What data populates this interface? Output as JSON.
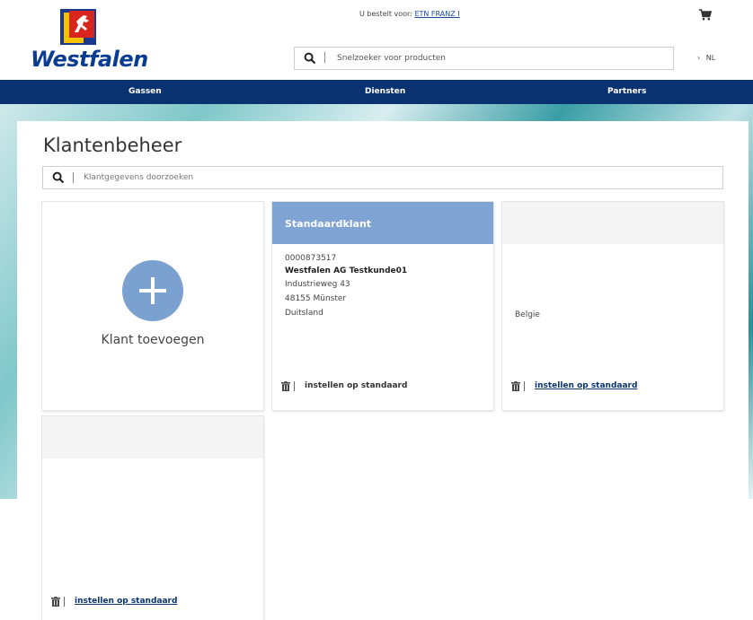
{
  "header": {
    "logo_text": "Westfalen",
    "order_for_label": "U bestelt voor:",
    "order_for_name": "ETN FRANZ I",
    "search_placeholder": "Snelzoeker voor producten",
    "language": "NL",
    "language_chevron": "›"
  },
  "nav": {
    "items": [
      {
        "label": "Gassen"
      },
      {
        "label": "Diensten"
      },
      {
        "label": "Partners"
      }
    ]
  },
  "main": {
    "title": "Klantenbeheer",
    "search_placeholder": "Klantgegevens doorzoeken",
    "add_label": "Klant toevoegen",
    "cards": [
      {
        "header": "Standaardklant",
        "number": "0000873517",
        "name": "Westfalen AG Testkunde01",
        "street": "Industrieweg 43",
        "city": "48155 Münster",
        "country": "Duitsland",
        "action": "instellen op standaard"
      },
      {
        "header": "",
        "country": "Belgie",
        "action": "instellen op standaard"
      },
      {
        "header": "",
        "action": "instellen op standaard"
      }
    ]
  },
  "colors": {
    "brand_blue": "#0a3270",
    "card_accent": "#7fa4d4",
    "add_circle": "#7ba1d1"
  },
  "icons": [
    "search-icon",
    "cart-icon",
    "trash-icon",
    "plus-icon",
    "chevron-right-icon"
  ]
}
